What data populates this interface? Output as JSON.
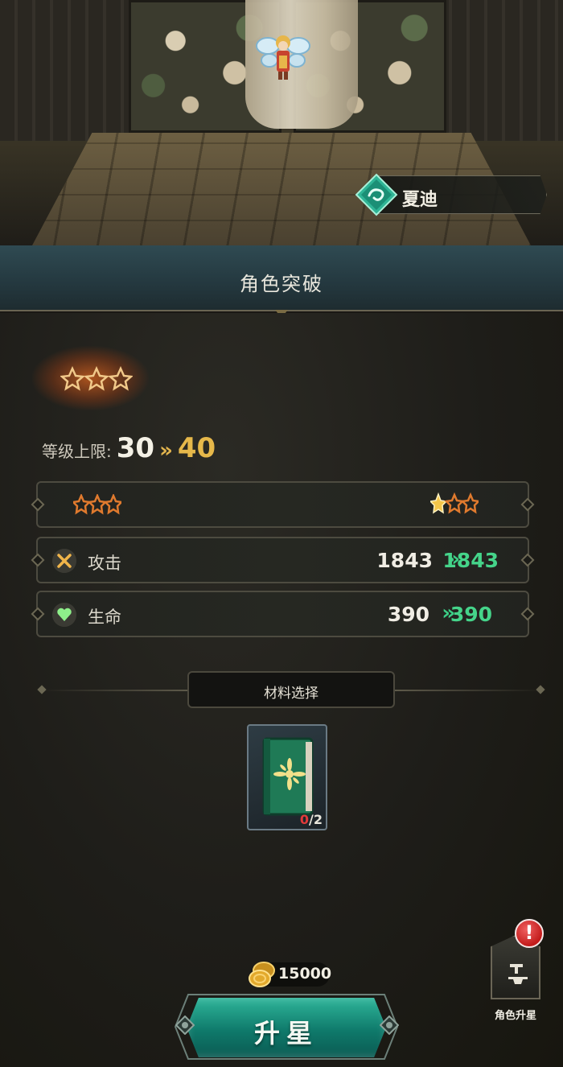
{
  "character": {
    "name": "夏迪"
  },
  "header": {
    "title": "角色突破"
  },
  "breakthrough": {
    "level_label": "等级上限:",
    "level_from": "30",
    "level_arrow": "»",
    "level_to": "40"
  },
  "stats": [
    {
      "label": "攻击",
      "old": "1843",
      "arrow": "»",
      "new": "1843",
      "icon": "sword-icon"
    },
    {
      "label": "生命",
      "old": "390",
      "arrow": "»",
      "new": "390",
      "icon": "heart-icon"
    }
  ],
  "materials": {
    "section_title": "材料选择",
    "item": {
      "have": "0",
      "need": "/2",
      "icon": "green-book-icon"
    }
  },
  "cost": {
    "amount": "15000",
    "icon": "gold-coin-icon"
  },
  "actions": {
    "upgrade_label": "升星",
    "side_label": "角色升星",
    "alert_mark": "!"
  },
  "colors": {
    "accent_green": "#45d48a",
    "level_gold": "#e6b84a",
    "button_teal": "#0f7a6b",
    "alert_red": "#c31b1b"
  }
}
